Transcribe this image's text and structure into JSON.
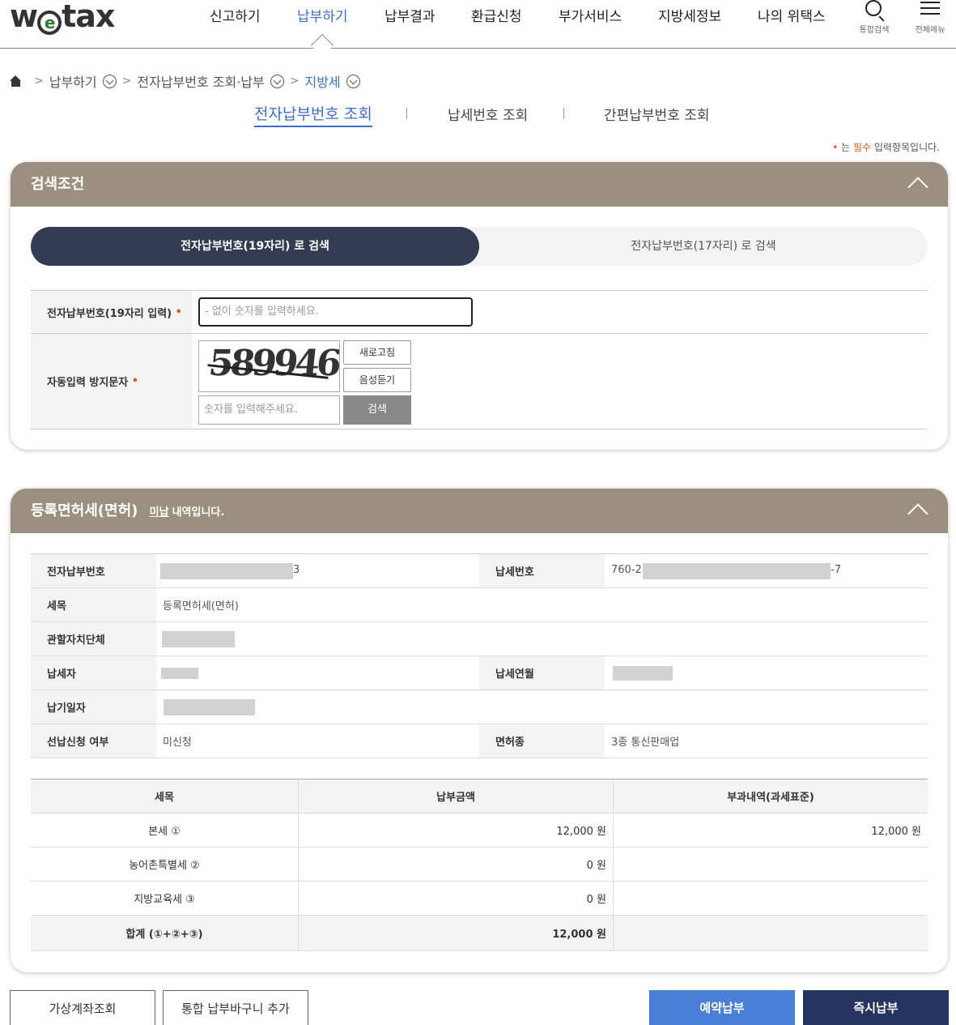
{
  "header": {
    "logo": "wetax",
    "nav": [
      "신고하기",
      "납부하기",
      "납부결과",
      "환급신청",
      "부가서비스",
      "지방세정보",
      "나의 위택스"
    ],
    "active_nav": "납부하기",
    "search_label": "통합검색",
    "menu_label": "전체메뉴"
  },
  "breadcrumb": {
    "items": [
      "납부하기",
      "전자납부번호 조회·납부",
      "지방세"
    ]
  },
  "subtabs": [
    "전자납부번호 조회",
    "납세번호 조회",
    "간편납부번호 조회"
  ],
  "required_note": {
    "dot": "•",
    "before": " 는 ",
    "word": "필수",
    "after": " 입력항목입니다."
  },
  "search_panel": {
    "title": "검색조건",
    "toggle_active": "전자납부번호(19자리) 로 검색",
    "toggle_inactive": "전자납부번호(17자리) 로 검색",
    "row1_label": "전자납부번호(19자리 입력)",
    "row1_placeholder": "- 없이 숫자를 입력하세요.",
    "row2_label": "자동입력 방지문자",
    "captcha_text": "589946",
    "refresh_label": "새로고침",
    "audio_label": "음성듣기",
    "captcha_placeholder": "숫자를 입력해주세요.",
    "search_label": "검색",
    "required_mark": "•"
  },
  "detail_panel": {
    "title": "등록면허세(면허)",
    "status_word": "미납",
    "status_suffix": "내역입니다.",
    "fields": {
      "epay_no_label": "전자납부번호",
      "epay_no_tail": "3",
      "tax_no_label": "납세번호",
      "tax_no_head": "760-2",
      "tax_no_tail": "-7",
      "tax_item_label": "세목",
      "tax_item_value": "등록면허세(면허)",
      "authority_label": "관할자치단체",
      "taxpayer_label": "납세자",
      "tax_month_label": "납세연월",
      "due_date_label": "납기일자",
      "prepay_label": "선납신청 여부",
      "prepay_value": "미신청",
      "license_label": "면허종",
      "license_value": "3종 통신판매업"
    },
    "amount_table": {
      "headers": [
        "세목",
        "납부금액",
        "부과내역(과세표준)"
      ],
      "rows": [
        {
          "item": "본세 ①",
          "amount": "12,000 원",
          "base": "12,000 원"
        },
        {
          "item": "농어촌특별세 ②",
          "amount": "0 원",
          "base": ""
        },
        {
          "item": "지방교육세 ③",
          "amount": "0 원",
          "base": ""
        }
      ],
      "total": {
        "item": "합계 (①+②+③)",
        "amount": "12,000 원",
        "base": ""
      }
    }
  },
  "bottom_buttons": {
    "virtual_account": "가상계좌조회",
    "add_basket": "통합 납부바구니 추가",
    "scheduled_pay": "예약납부",
    "instant_pay": "즉시납부"
  }
}
